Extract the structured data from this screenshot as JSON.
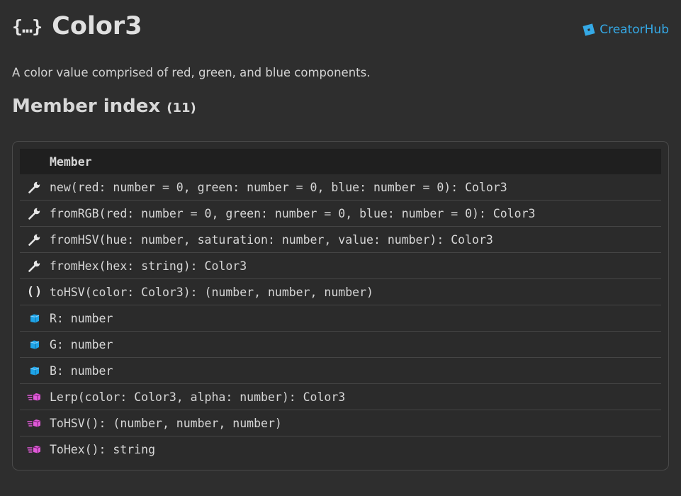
{
  "header": {
    "type_icon": "{…}",
    "title": "Color3",
    "hub_link": "CreatorHub"
  },
  "description": "A color value comprised of red, green, and blue components.",
  "member_index": {
    "title": "Member index",
    "count": "(11)",
    "column_header": "Member",
    "rows": [
      {
        "icon": "wrench-icon",
        "text": "new(red: number = 0, green: number = 0, blue: number = 0): Color3"
      },
      {
        "icon": "wrench-icon",
        "text": "fromRGB(red: number = 0, green: number = 0, blue: number = 0): Color3"
      },
      {
        "icon": "wrench-icon",
        "text": "fromHSV(hue: number, saturation: number, value: number): Color3"
      },
      {
        "icon": "wrench-icon",
        "text": "fromHex(hex: string): Color3"
      },
      {
        "icon": "parentheses-icon",
        "glyph": "()",
        "text": "toHSV(color: Color3): (number, number, number)"
      },
      {
        "icon": "property-cube-icon",
        "text": "R: number"
      },
      {
        "icon": "property-cube-icon",
        "text": "G: number"
      },
      {
        "icon": "property-cube-icon",
        "text": "B: number"
      },
      {
        "icon": "method-icon",
        "text": "Lerp(color: Color3, alpha: number): Color3"
      },
      {
        "icon": "method-icon",
        "text": "ToHSV(): (number, number, number)"
      },
      {
        "icon": "method-icon",
        "text": "ToHex(): string"
      }
    ]
  },
  "colors": {
    "background": "#2e2e2e",
    "link": "#35a9e6",
    "property_icon": "#1fa4e8",
    "method_icon": "#e05ad8"
  }
}
